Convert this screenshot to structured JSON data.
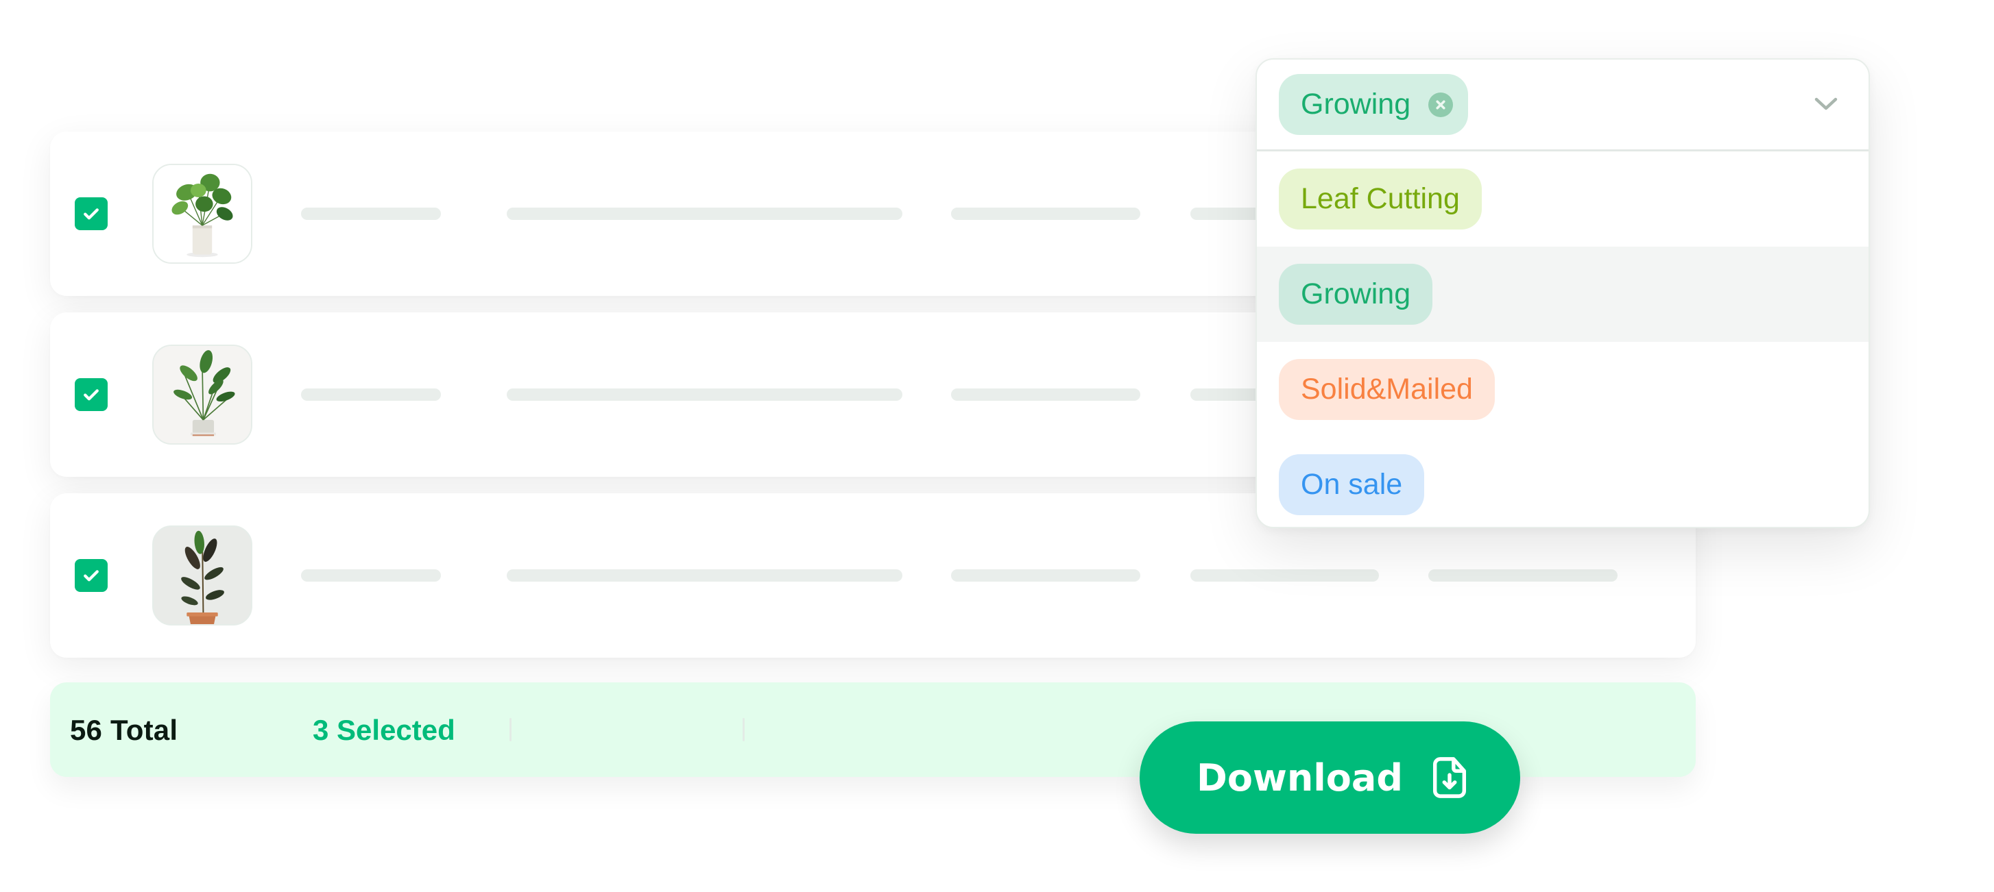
{
  "table": {
    "rows": [
      {
        "checked": true,
        "thumbnail": "monstera-plant",
        "placeholder_bars": 5
      },
      {
        "checked": true,
        "thumbnail": "bird-of-paradise-plant",
        "placeholder_bars": 5
      },
      {
        "checked": true,
        "thumbnail": "rubber-plant",
        "placeholder_bars": 5
      }
    ]
  },
  "footer": {
    "total_label": "56 Total",
    "selected_label": "3 Selected"
  },
  "download_button": {
    "label": "Download",
    "icon": "file-download-icon"
  },
  "status_dropdown": {
    "selected": {
      "label": "Growing",
      "icon": "close-circle-icon"
    },
    "chevron_icon": "chevron-down-icon",
    "options": [
      {
        "label": "Leaf Cutting",
        "text_color": "#77a90d",
        "bg_color": "#e8f5d0"
      },
      {
        "label": "Growing",
        "text_color": "#19ad6e",
        "bg_color": "#cdeadf",
        "highlighted": true
      },
      {
        "label": "Solid&Mailed",
        "text_color": "#f88141",
        "bg_color": "#ffe6da"
      },
      {
        "label": "On sale",
        "text_color": "#3594f0",
        "bg_color": "#d7e9fc"
      }
    ]
  },
  "colors": {
    "accent": "#00bb7a",
    "footer_bg": "#e2fdec",
    "placeholder": "#e9eeeb"
  }
}
